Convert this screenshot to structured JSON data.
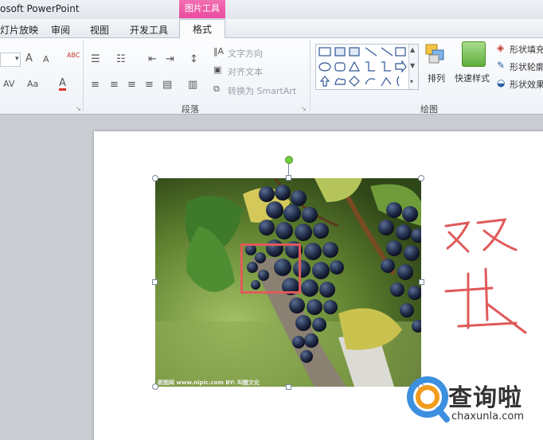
{
  "app": {
    "title": "osoft PowerPoint",
    "context_tab_group": "图片工具"
  },
  "tabs": [
    {
      "label": "灯片放映"
    },
    {
      "label": "审阅"
    },
    {
      "label": "视图"
    },
    {
      "label": "开发工具"
    },
    {
      "label": "格式",
      "active": true
    }
  ],
  "ribbon": {
    "font_group": {
      "grow_font": "A",
      "shrink_font": "A",
      "clear_format": "ABC",
      "char_spacing": "AV",
      "change_case": "Aa",
      "font_color": "A"
    },
    "paragraph_group": {
      "label": "段落",
      "text_direction": "文字方向",
      "align_text": "对齐文本",
      "convert_smartart": "转换为 SmartArt"
    },
    "drawing_group": {
      "label": "绘图",
      "arrange": "排列",
      "quick_styles": "快速样式",
      "shape_fill": "形状填充",
      "shape_outline": "形状轮廓",
      "shape_effects": "形状效果"
    }
  },
  "slide": {
    "photo_caption": "昵图网 www.nipic.com   BY: 叫醒文化",
    "annotation_text": "双击"
  },
  "watermark": {
    "name": "查询啦",
    "url": "chaxunla.com"
  },
  "colors": {
    "context_tab": "#e94b9d",
    "highlight_box": "#e05a5a",
    "annotation": "#e05a5a",
    "watermark_accent": "#3d8fe0"
  }
}
